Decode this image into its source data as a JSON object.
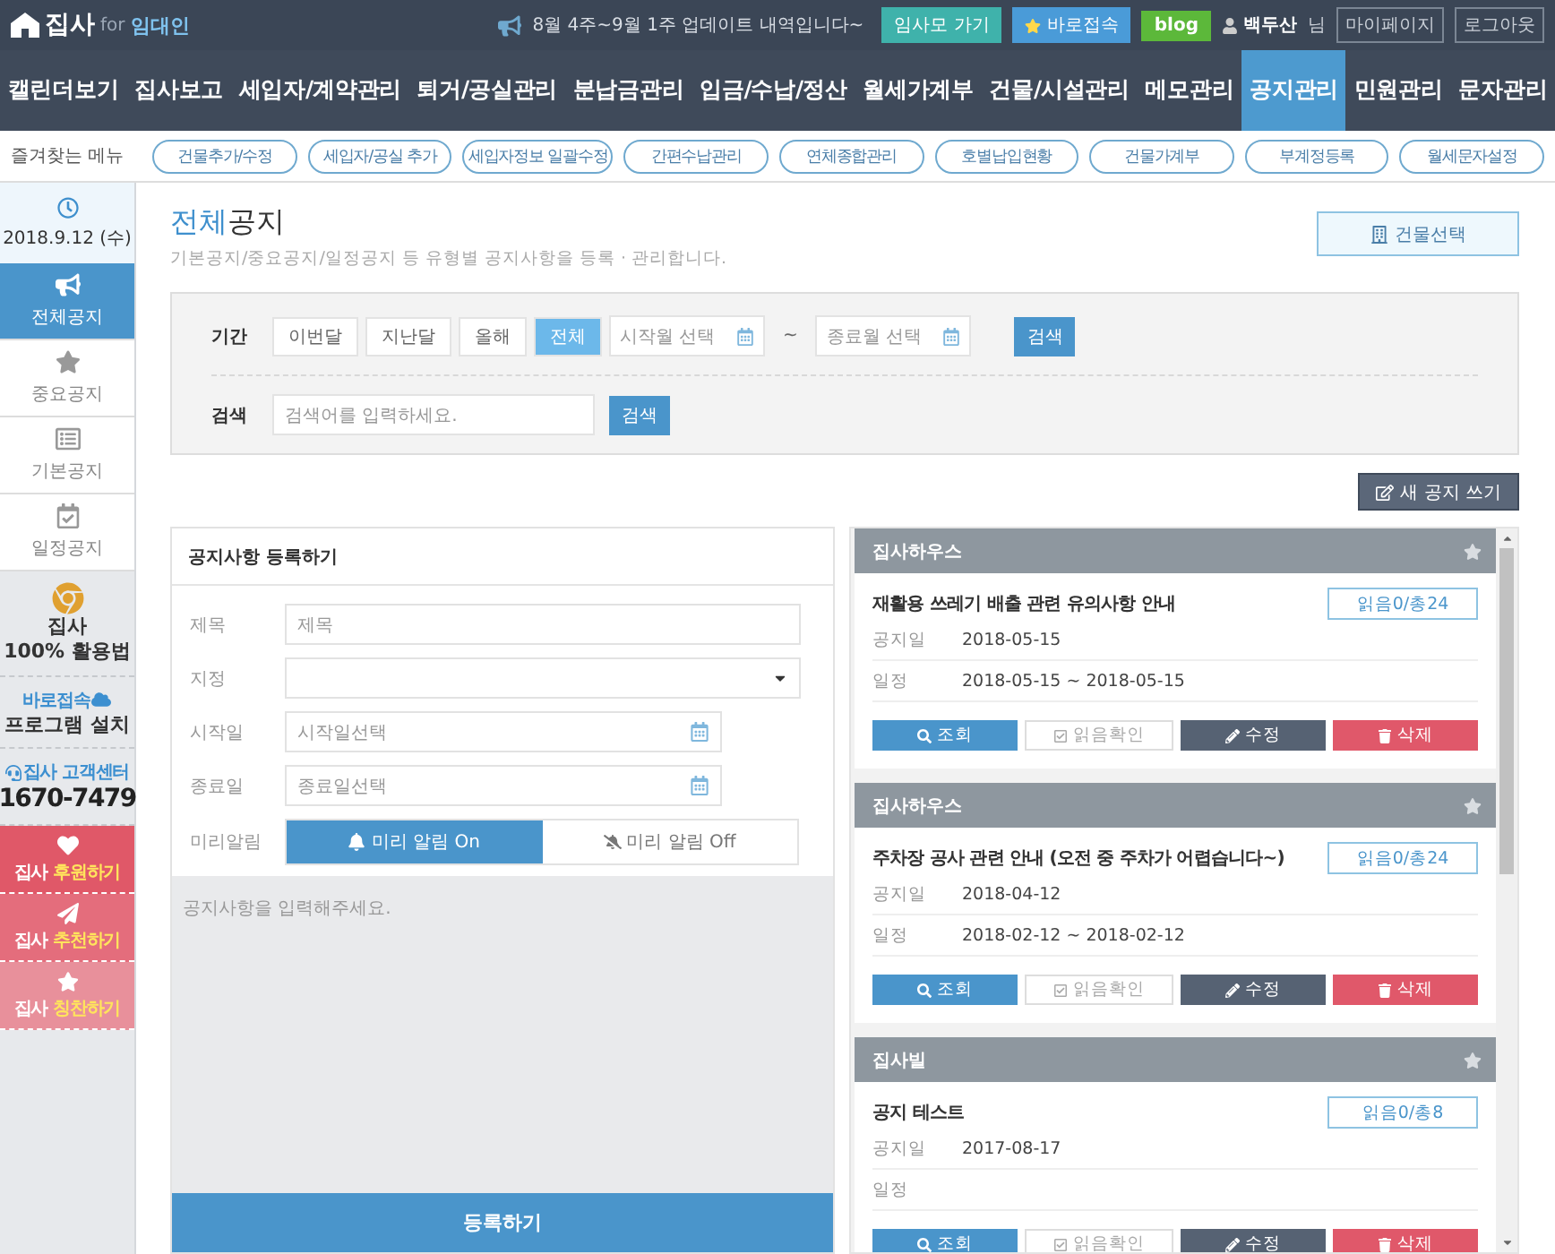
{
  "top_bar": {
    "logo": {
      "name": "집사",
      "connector": "for",
      "audience": "임대인"
    },
    "notice": "8월 4주~9월 1주 업데이트 내역입니다~",
    "buttons": [
      {
        "label": "임사모 가기",
        "kind": "teal"
      },
      {
        "label": "바로접속",
        "kind": "star"
      },
      {
        "label": "blog",
        "kind": "green"
      }
    ],
    "user": {
      "name": "백두산",
      "suffix": "님"
    },
    "links": [
      "마이페이지",
      "로그아웃"
    ]
  },
  "nav": [
    {
      "label": "캘린더보기",
      "selected": false
    },
    {
      "label": "집사보고",
      "selected": false
    },
    {
      "label": "세입자/계약관리",
      "selected": false
    },
    {
      "label": "퇴거/공실관리",
      "selected": false
    },
    {
      "label": "분납금관리",
      "selected": false
    },
    {
      "label": "입금/수납/정산",
      "selected": false
    },
    {
      "label": "월세가계부",
      "selected": false
    },
    {
      "label": "건물/시설관리",
      "selected": false
    },
    {
      "label": "메모관리",
      "selected": false
    },
    {
      "label": "공지관리",
      "selected": true
    },
    {
      "label": "민원관리",
      "selected": false
    },
    {
      "label": "문자관리",
      "selected": false
    }
  ],
  "favorites": {
    "label": "즐겨찾는 메뉴",
    "items": [
      "건물추가/수정",
      "세입자/공실 추가",
      "세입자정보 일괄수정",
      "간편수납관리",
      "연체종합관리",
      "호별납입현황",
      "건물가계부",
      "부계정등록",
      "월세문자설정"
    ]
  },
  "sidebar": {
    "date": "2018.9.12 (수)",
    "items": [
      {
        "label": "전체공지",
        "selected": true
      },
      {
        "label": "중요공지",
        "selected": false
      },
      {
        "label": "기본공지",
        "selected": false
      },
      {
        "label": "일정공지",
        "selected": false
      }
    ],
    "guide": {
      "title": "집사",
      "subtitle": "100% 활용법"
    },
    "install": {
      "title": "바로접속",
      "subtitle": "프로그램 설치"
    },
    "support": {
      "title": "집사 고객센터",
      "phone": "1670-7479"
    },
    "promos": [
      {
        "prefix": "집사",
        "highlight": "후원하기"
      },
      {
        "prefix": "집사",
        "highlight": "추천하기"
      },
      {
        "prefix": "집사",
        "highlight": "칭찬하기"
      }
    ]
  },
  "header": {
    "title_highlight": "전체",
    "title_rest": "공지",
    "subtitle": "기본공지/중요공지/일정공지 등 유형별 공지사항을 등록 · 관리합니다.",
    "building_button": "건물선택"
  },
  "filter": {
    "period_label": "기간",
    "periods": [
      {
        "label": "이번달",
        "selected": false
      },
      {
        "label": "지난달",
        "selected": false
      },
      {
        "label": "올해",
        "selected": false
      },
      {
        "label": "전체",
        "selected": true
      }
    ],
    "start_placeholder": "시작월 선택",
    "separator": "~",
    "end_placeholder": "종료월 선택",
    "period_button": "검색",
    "search_label": "검색",
    "search_placeholder": "검색어를 입력하세요.",
    "search_button": "검색"
  },
  "new_notice_button": "새 공지 쓰기",
  "form": {
    "title": "공지사항 등록하기",
    "fields": [
      {
        "label": "제목",
        "kind": "text",
        "placeholder": "제목"
      },
      {
        "label": "지정",
        "kind": "select"
      },
      {
        "label": "시작일",
        "kind": "date",
        "placeholder": "시작일선택"
      },
      {
        "label": "종료일",
        "kind": "date",
        "placeholder": "종료일선택"
      }
    ],
    "alert": {
      "label": "미리알림",
      "options": [
        {
          "label": "미리 알림 On",
          "selected": true
        },
        {
          "label": "미리 알림 Off",
          "selected": false
        }
      ]
    },
    "body_placeholder": "공지사항을 입력해주세요.",
    "submit": "등록하기"
  },
  "notices": [
    {
      "building": "집사하우스",
      "title": "재활용 쓰레기 배출 관련 유의사항 안내",
      "read": "읽음0/총24",
      "posted_label": "공지일",
      "posted": "2018-05-15",
      "schedule_label": "일정",
      "schedule": "2018-05-15 ~ 2018-05-15",
      "actions": [
        {
          "label": "조회",
          "kind": "view"
        },
        {
          "label": "읽음확인",
          "kind": "check"
        },
        {
          "label": "수정",
          "kind": "edit"
        },
        {
          "label": "삭제",
          "kind": "delete"
        }
      ]
    },
    {
      "building": "집사하우스",
      "title": "주차장 공사 관련 안내 (오전 중 주차가 어렵습니다~)",
      "read": "읽음0/총24",
      "posted_label": "공지일",
      "posted": "2018-04-12",
      "schedule_label": "일정",
      "schedule": "2018-02-12 ~ 2018-02-12",
      "actions": [
        {
          "label": "조회",
          "kind": "view"
        },
        {
          "label": "읽음확인",
          "kind": "check"
        },
        {
          "label": "수정",
          "kind": "edit"
        },
        {
          "label": "삭제",
          "kind": "delete"
        }
      ]
    },
    {
      "building": "집사빌",
      "title": "공지 테스트",
      "read": "읽음0/총8",
      "posted_label": "공지일",
      "posted": "2017-08-17",
      "schedule_label": "일정",
      "actions": [
        {
          "label": "조회",
          "kind": "view"
        },
        {
          "label": "읽음확인",
          "kind": "check"
        },
        {
          "label": "수정",
          "kind": "edit"
        },
        {
          "label": "삭제",
          "kind": "delete"
        }
      ]
    }
  ]
}
